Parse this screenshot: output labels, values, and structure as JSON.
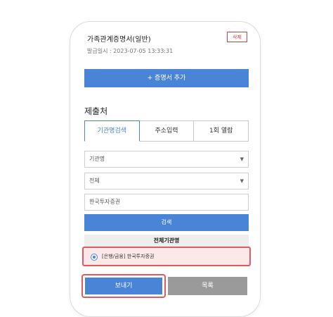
{
  "document": {
    "title": "가족관계증명서(일반)",
    "issued": "발급일시 : 2023-07-05 13:33:31",
    "delete_label": "삭제"
  },
  "add_button": "+ 증명서 추가",
  "submit_section": {
    "title": "제출처",
    "tabs": [
      {
        "label": "기관명검색",
        "active": true
      },
      {
        "label": "주소입력",
        "active": false
      },
      {
        "label": "1회 열람",
        "active": false
      }
    ],
    "institution_select": {
      "value": "기관명",
      "caret": "▼"
    },
    "category_select": {
      "value": "전체",
      "caret": "▼"
    },
    "search_input": {
      "value": "한국투자증권"
    },
    "search_button": "검색",
    "results_header": "전체기관명",
    "results": [
      {
        "label": "[은행/금융] 한국투자증권",
        "selected": true
      }
    ]
  },
  "actions": {
    "send": "보내기",
    "list": "목록"
  },
  "colors": {
    "accent": "#4a84d6",
    "highlight": "#e05a60",
    "delete": "#e23b3b",
    "secondary_button": "#9a9a9a"
  }
}
